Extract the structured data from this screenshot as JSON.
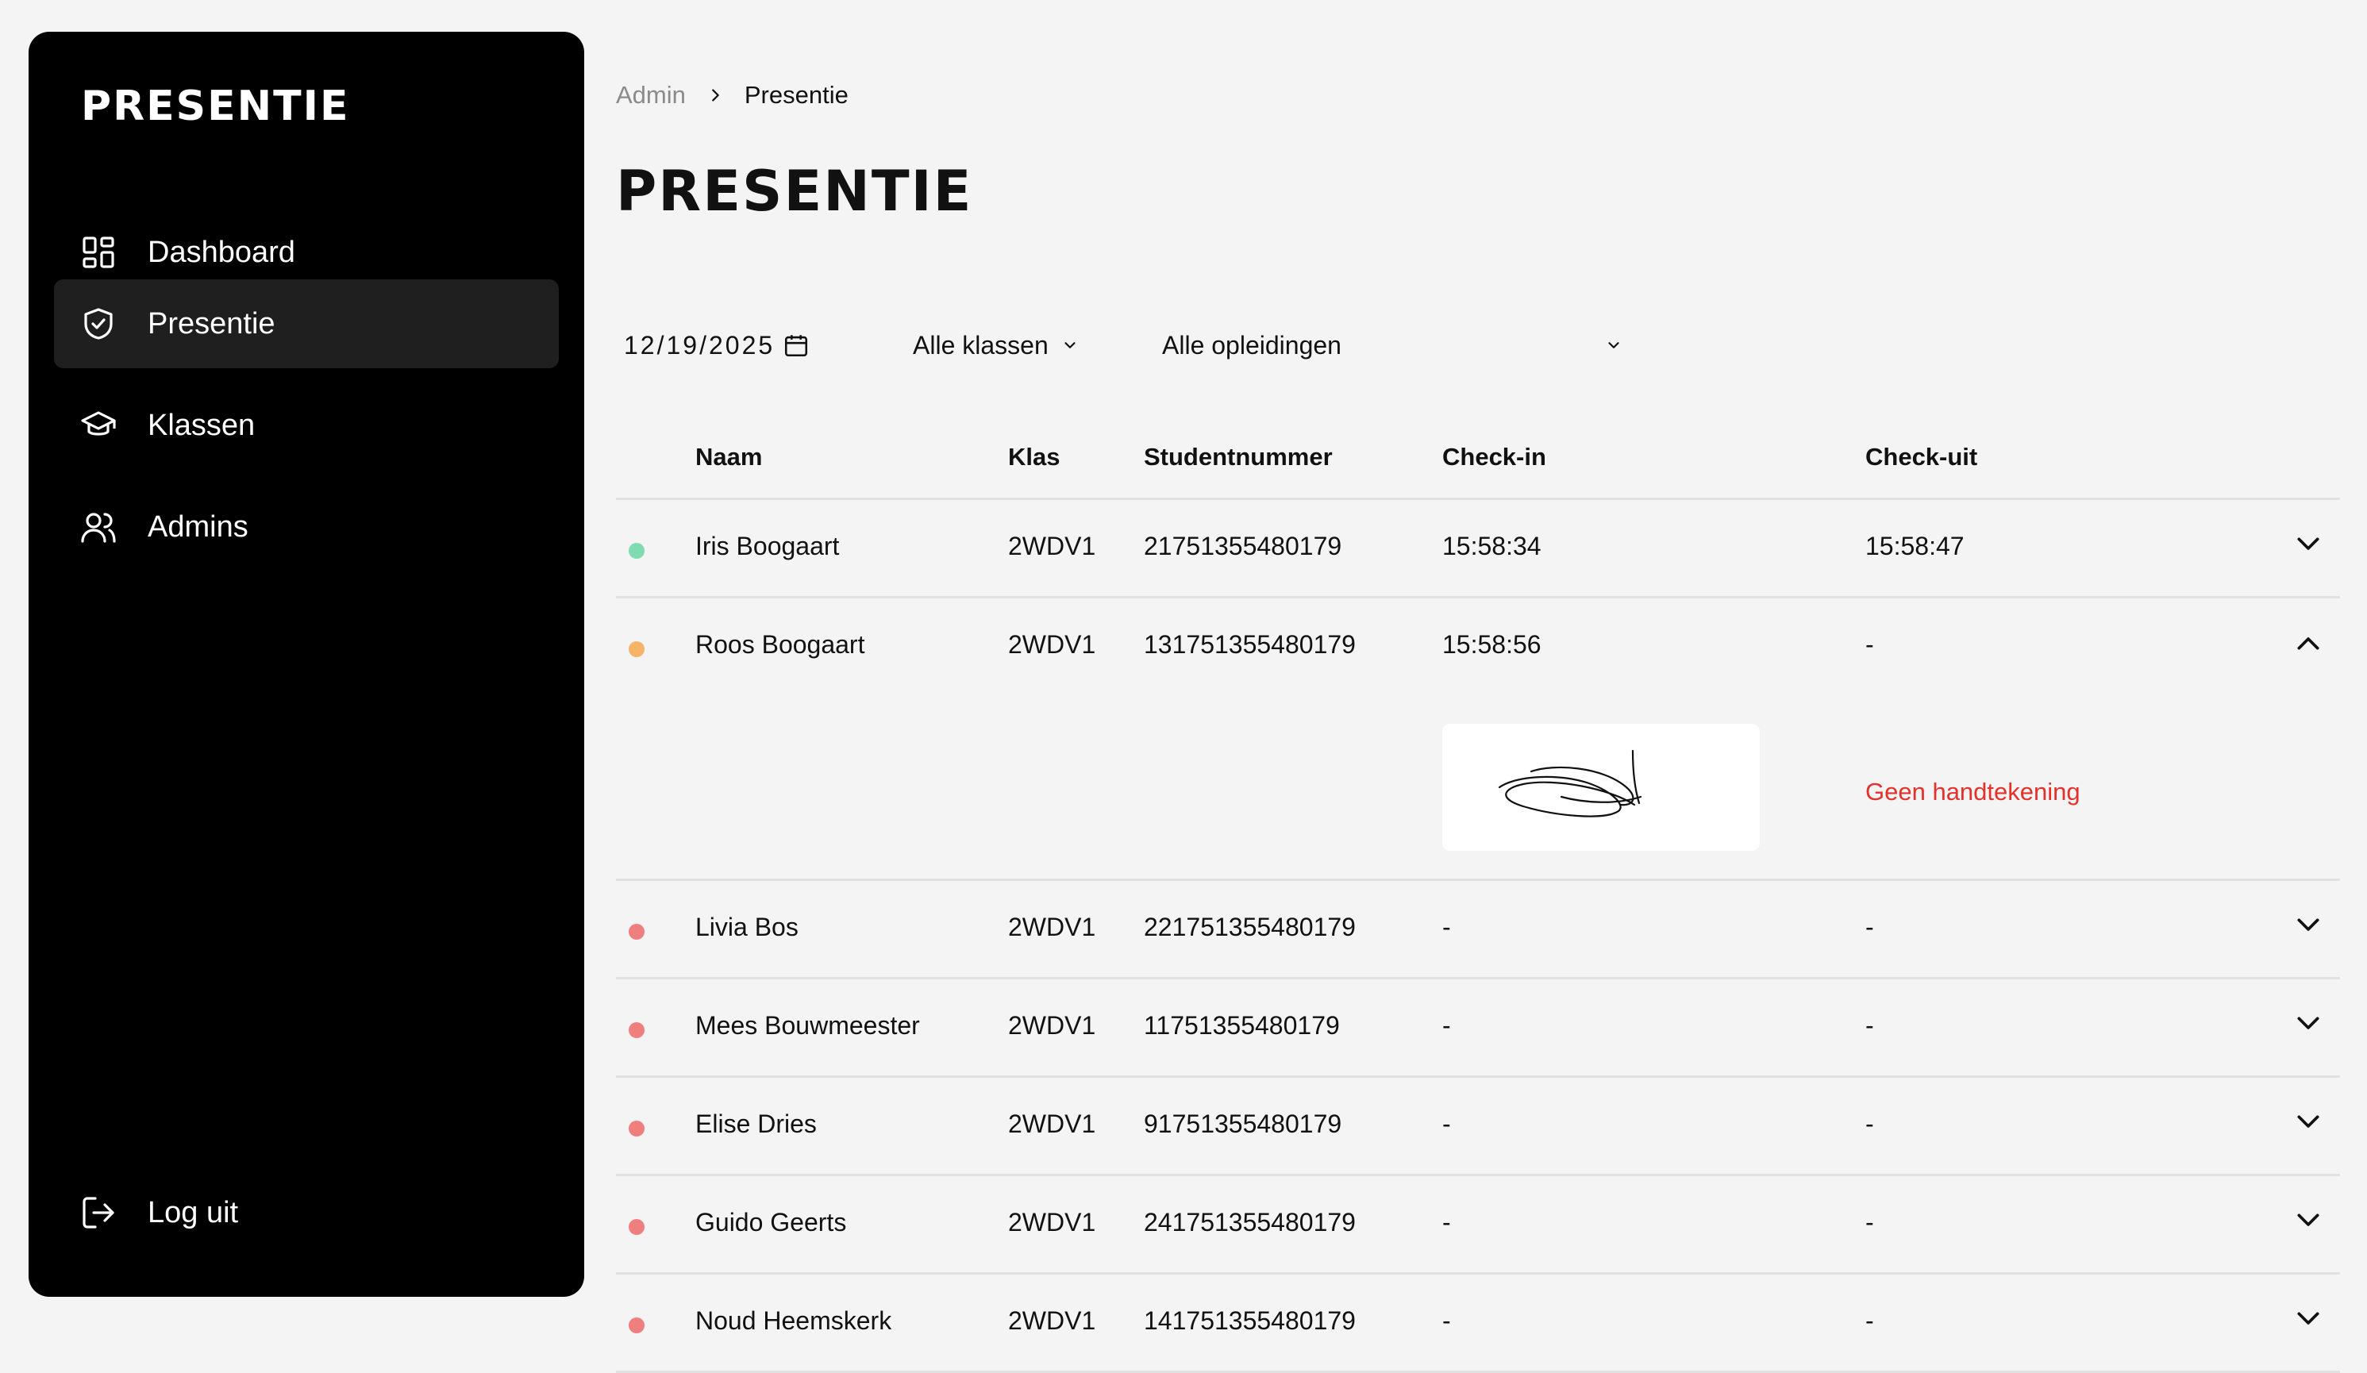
{
  "sidebar": {
    "logo": "PRESENTIE",
    "items": [
      {
        "label": "Dashboard",
        "icon": "dashboard-icon"
      },
      {
        "label": "Presentie",
        "icon": "shield-check-icon",
        "active": true
      },
      {
        "label": "Klassen",
        "icon": "graduation-cap-icon"
      },
      {
        "label": "Admins",
        "icon": "users-icon"
      }
    ],
    "logout": {
      "label": "Log uit",
      "icon": "logout-icon"
    }
  },
  "breadcrumb": {
    "root": "Admin",
    "current": "Presentie"
  },
  "page_title": "PRESENTIE",
  "filters": {
    "date": "12/19/2025",
    "class": "Alle klassen",
    "education": "Alle opleidingen"
  },
  "table": {
    "headers": {
      "name": "Naam",
      "klas": "Klas",
      "studentnummer": "Studentnummer",
      "checkin": "Check-in",
      "checkout": "Check-uit"
    },
    "rows": [
      {
        "status": "green",
        "name": "Iris Boogaart",
        "klas": "2WDV1",
        "studentnummer": "21751355480179",
        "checkin": "15:58:34",
        "checkout": "15:58:47",
        "expanded": false
      },
      {
        "status": "orange",
        "name": "Roos Boogaart",
        "klas": "2WDV1",
        "studentnummer": "131751355480179",
        "checkin": "15:58:56",
        "checkout": "-",
        "expanded": true,
        "no_signature_text": "Geen handtekening"
      },
      {
        "status": "red",
        "name": "Livia Bos",
        "klas": "2WDV1",
        "studentnummer": "221751355480179",
        "checkin": "-",
        "checkout": "-",
        "expanded": false
      },
      {
        "status": "red",
        "name": "Mees Bouwmeester",
        "klas": "2WDV1",
        "studentnummer": "11751355480179",
        "checkin": "-",
        "checkout": "-",
        "expanded": false
      },
      {
        "status": "red",
        "name": "Elise Dries",
        "klas": "2WDV1",
        "studentnummer": "91751355480179",
        "checkin": "-",
        "checkout": "-",
        "expanded": false
      },
      {
        "status": "red",
        "name": "Guido Geerts",
        "klas": "2WDV1",
        "studentnummer": "241751355480179",
        "checkin": "-",
        "checkout": "-",
        "expanded": false
      },
      {
        "status": "red",
        "name": "Noud Heemskerk",
        "klas": "2WDV1",
        "studentnummer": "141751355480179",
        "checkin": "-",
        "checkout": "-",
        "expanded": false
      }
    ]
  },
  "colors": {
    "green": "#7fdcb0",
    "orange": "#f6b46a",
    "red": "#ef7f7f",
    "error": "#e5312b",
    "sidebar": "#000000",
    "active": "#1f1f1f"
  }
}
